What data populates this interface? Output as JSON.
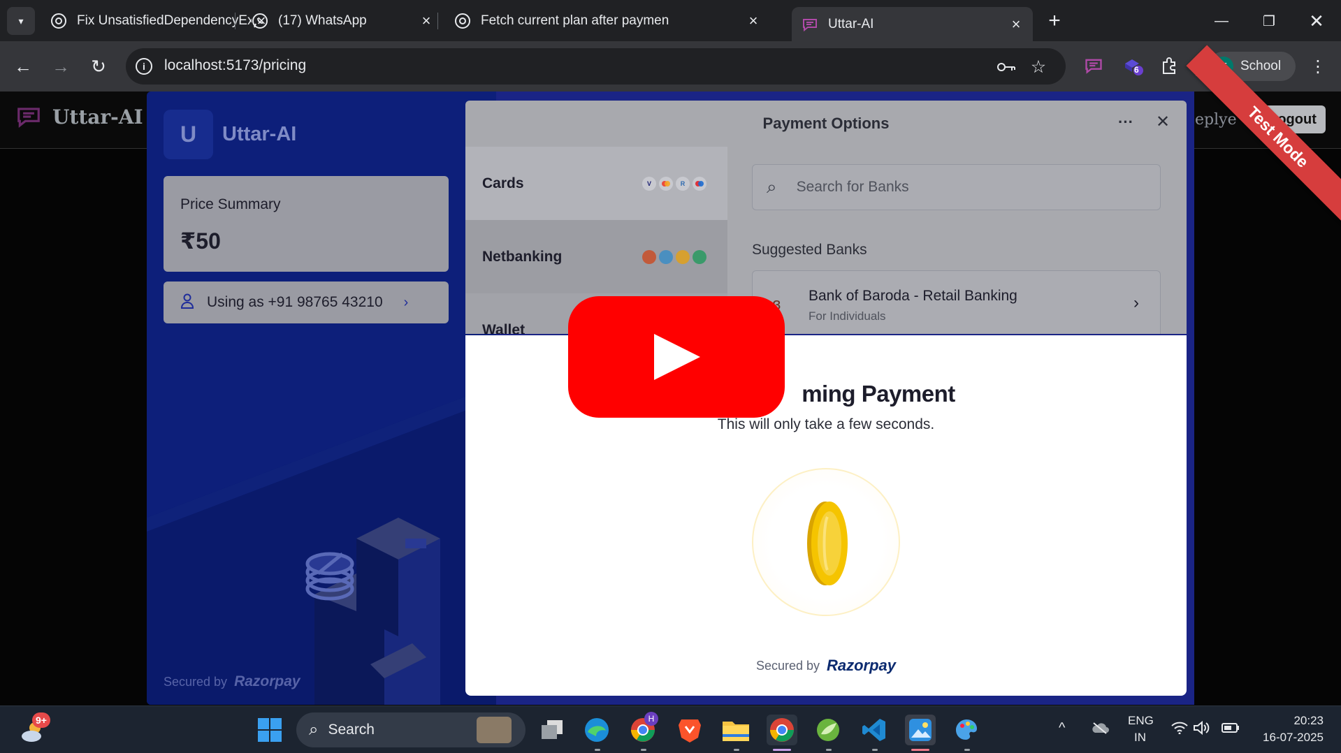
{
  "browser": {
    "tabs": [
      {
        "title": "Fix UnsatisfiedDependencyExce",
        "icon": "chatgpt-icon"
      },
      {
        "title": "(17) WhatsApp",
        "icon": "whatsapp-icon"
      },
      {
        "title": "Fetch current plan after paymen",
        "icon": "chatgpt-icon"
      },
      {
        "title": "Uttar-AI",
        "icon": "uttar-ai-icon"
      }
    ],
    "active_tab": 3,
    "url": "localhost:5173/pricing",
    "extension_badge": "6",
    "profile_initial": "T",
    "profile_name": "School"
  },
  "site": {
    "logo": "Uttar-AI",
    "nav_partial": "eplye",
    "logout": "Logout"
  },
  "checkout": {
    "merchant_initial": "U",
    "merchant_name": "Uttar-AI",
    "price_label": "Price Summary",
    "price": "₹50",
    "contact": "Using as +91 98765 43210",
    "secured_by": "Secured by",
    "brand": "Razorpay",
    "options_title": "Payment Options",
    "methods": [
      {
        "label": "Cards"
      },
      {
        "label": "Netbanking"
      },
      {
        "label": "Wallet"
      }
    ],
    "bank_search_placeholder": "Search for Banks",
    "suggested_label": "Suggested Banks",
    "bank_name": "Bank of Baroda - Retail Banking",
    "bank_sub": "For Individuals",
    "confirm_title_partial": "ming Payment",
    "confirm_sub": "This will only take a few seconds.",
    "test_mode": "Test Mode"
  },
  "taskbar": {
    "weather_badge": "9+",
    "search_label": "Search",
    "chrome_badge": "H",
    "language_1": "ENG",
    "language_2": "IN",
    "time": "20:23",
    "date": "16-07-2025"
  },
  "colors": {
    "checkout_theme": "#0d1f7a",
    "youtube_red": "#ff0000",
    "test_mode_ribbon": "#d63d3d",
    "coin_gold": "#f5c400"
  }
}
